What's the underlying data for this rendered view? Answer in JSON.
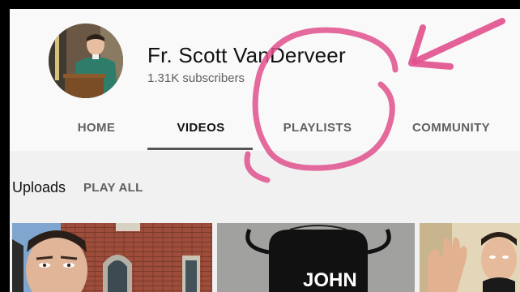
{
  "channel": {
    "name": "Fr. Scott VanDerveer",
    "subscribers": "1.31K subscribers"
  },
  "tabs": [
    {
      "label": "HOME"
    },
    {
      "label": "VIDEOS"
    },
    {
      "label": "PLAYLISTS"
    },
    {
      "label": "COMMUNITY"
    }
  ],
  "active_tab": "VIDEOS",
  "uploads": {
    "title": "Uploads",
    "play_all": "PLAY ALL"
  },
  "thumbnails": [
    {
      "id": "thumb-1"
    },
    {
      "id": "thumb-2",
      "text": "JOHN"
    },
    {
      "id": "thumb-3"
    }
  ],
  "annotation_color": "#e0508c"
}
